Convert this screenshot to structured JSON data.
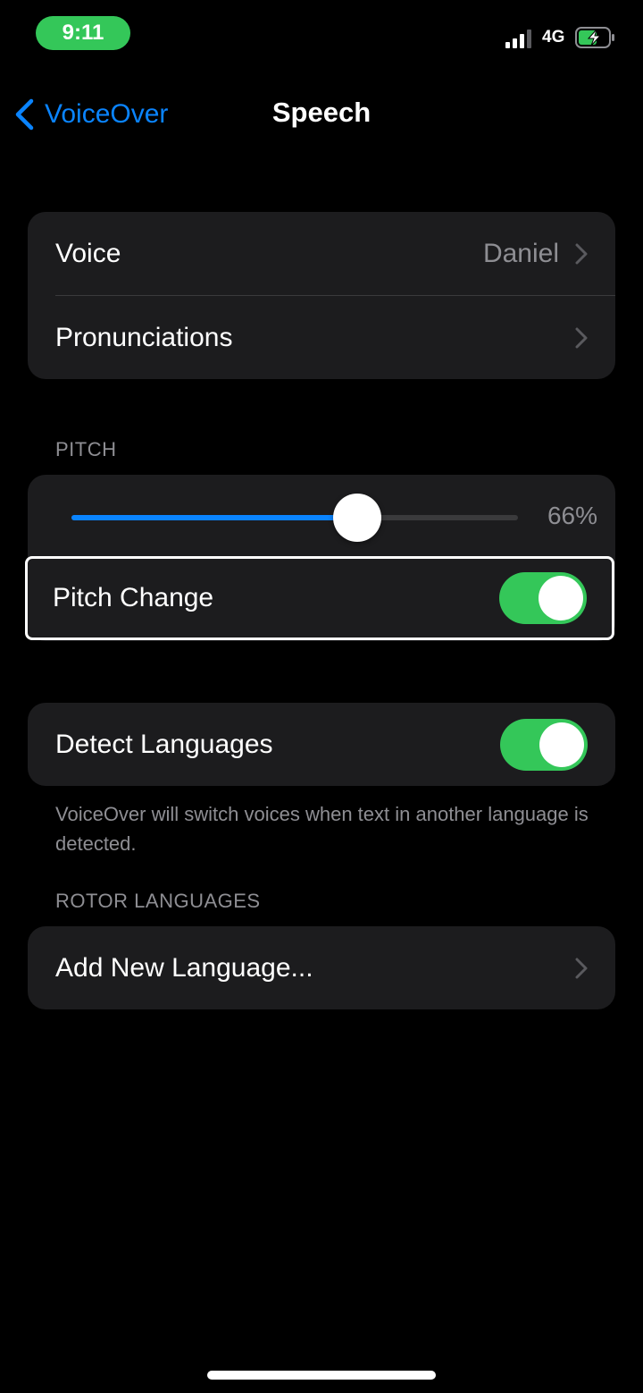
{
  "status_bar": {
    "time": "9:11",
    "network": "4G"
  },
  "nav": {
    "back_label": "VoiceOver",
    "title": "Speech"
  },
  "group_voice": {
    "voice_label": "Voice",
    "voice_value": "Daniel",
    "pronunciations_label": "Pronunciations"
  },
  "pitch": {
    "section_header": "PITCH",
    "slider_percent_text": "66%",
    "slider_value": 0.64,
    "pitch_change_label": "Pitch Change",
    "pitch_change_on": true
  },
  "languages": {
    "detect_label": "Detect Languages",
    "detect_on": true,
    "footer": "VoiceOver will switch voices when text in another language is detected.",
    "rotor_header": "ROTOR LANGUAGES",
    "add_label": "Add New Language..."
  },
  "colors": {
    "accent": "#0a84ff",
    "switch_on": "#34c759",
    "cell_bg": "#1c1c1e"
  },
  "icons": [
    "back-chevron-icon",
    "chevron-right-icon",
    "signal-icon",
    "battery-charging-icon"
  ]
}
